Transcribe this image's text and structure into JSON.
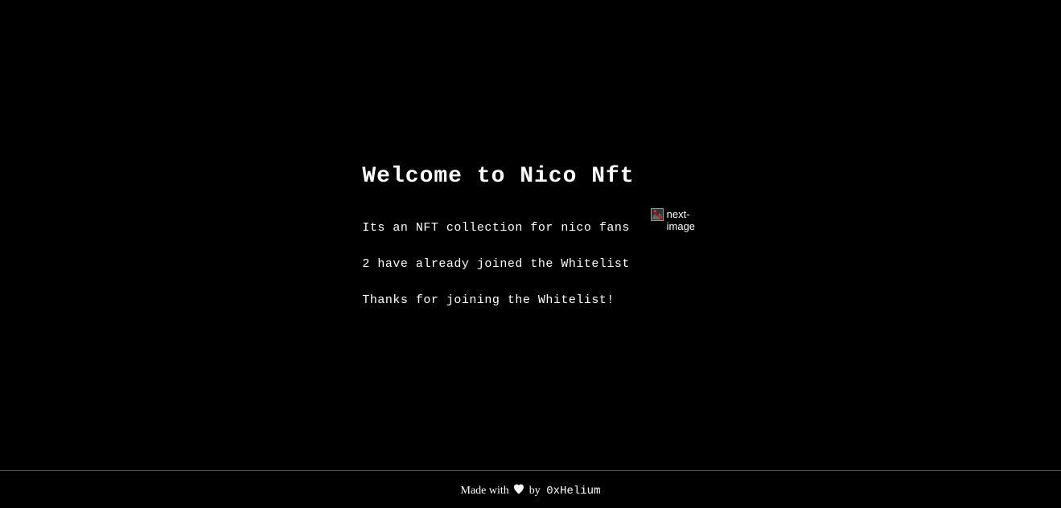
{
  "main": {
    "title": "Welcome to Nico Nft",
    "description": "Its an NFT collection for nico fans",
    "whitelist_count": "2 have already joined the Whitelist",
    "thanks_message": "Thanks for joining the Whitelist!"
  },
  "image": {
    "alt_text": "next-image"
  },
  "footer": {
    "prefix": "Made with",
    "suffix": "by",
    "author": "0xHelium"
  }
}
